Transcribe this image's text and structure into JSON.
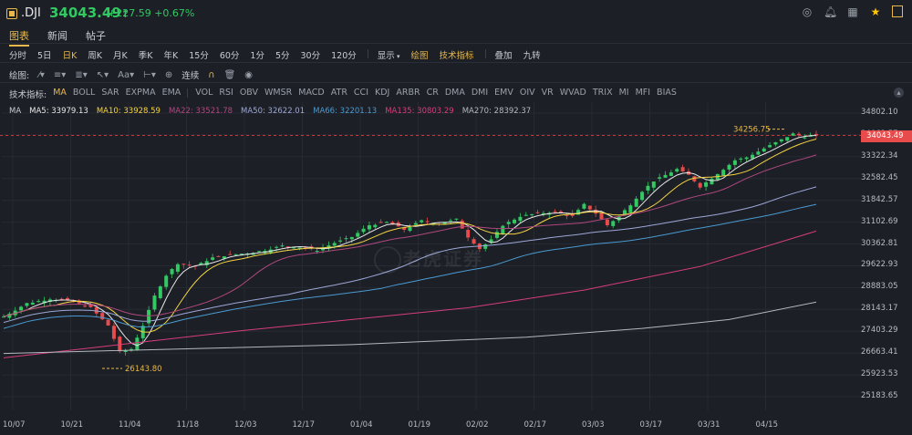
{
  "header": {
    "symbol": ".DJI",
    "price": "34043.49",
    "price_arrow": "↑",
    "change": "+227.59",
    "change_pct": "+0.67%",
    "up_color": "#32c862",
    "down_color": "#e84b4b",
    "accent": "#e8b94a"
  },
  "tabs": [
    "图表",
    "新闻",
    "帖子"
  ],
  "periods": [
    "分时",
    "5日",
    "日K",
    "周K",
    "月K",
    "季K",
    "年K",
    "15分",
    "60分",
    "1分",
    "5分",
    "30分",
    "120分"
  ],
  "period_tools": {
    "display": "显示",
    "draw": "绘图",
    "indicators": "技术指标",
    "overlay": "叠加",
    "nine": "九转"
  },
  "draw_toolbar": {
    "label": "绘图:",
    "continuous": "连续"
  },
  "indicator_bar": {
    "label": "技术指标:",
    "main": [
      "MA",
      "BOLL",
      "SAR",
      "EXPMA",
      "EMA"
    ],
    "sub": [
      "VOL",
      "RSI",
      "OBV",
      "WMSR",
      "MACD",
      "ATR",
      "CCI",
      "KDJ",
      "ARBR",
      "CR",
      "DMA",
      "DMI",
      "EMV",
      "OIV",
      "VR",
      "WVAD",
      "TRIX",
      "MI",
      "MFI",
      "BIAS"
    ]
  },
  "ma_legend": [
    {
      "text": "MA",
      "color": "#c9ccd3"
    },
    {
      "text": "MA5: 33979.13",
      "color": "#e8e8e8"
    },
    {
      "text": "MA10: 33928.59",
      "color": "#f5d442"
    },
    {
      "text": "MA22: 33521.78",
      "color": "#b0487e"
    },
    {
      "text": "MA50: 32622.01",
      "color": "#9da7d6"
    },
    {
      "text": "MA66: 32201.13",
      "color": "#4a9ad1"
    },
    {
      "text": "MA135: 30803.29",
      "color": "#d63d7e"
    },
    {
      "text": "MA270: 28392.37",
      "color": "#b5b8bf"
    }
  ],
  "watermark": "老虎证券",
  "chart_data": {
    "type": "candlestick",
    "y_ticks": [
      "34802.10",
      "34062.57",
      "33322.34",
      "32582.45",
      "31842.57",
      "31102.69",
      "30362.81",
      "29622.93",
      "28883.05",
      "28143.17",
      "27403.29",
      "26663.41",
      "25923.53",
      "25183.65"
    ],
    "y_range": [
      25183.65,
      34802.1
    ],
    "current_price_label": "34043.49",
    "x_labels": [
      "10/07",
      "10/21",
      "11/04",
      "11/18",
      "12/03",
      "12/17",
      "01/04",
      "01/19",
      "02/02",
      "02/17",
      "03/03",
      "03/17",
      "03/31",
      "04/15"
    ],
    "annotations": {
      "high": "34256.75",
      "low": "26143.80"
    },
    "close_path": [
      [
        0,
        27900
      ],
      [
        4,
        28350
      ],
      [
        8,
        28500
      ],
      [
        12,
        28400
      ],
      [
        15,
        28200
      ],
      [
        18,
        27600
      ],
      [
        20,
        26700
      ],
      [
        22,
        26800
      ],
      [
        24,
        27600
      ],
      [
        26,
        28600
      ],
      [
        28,
        29300
      ],
      [
        30,
        29700
      ],
      [
        33,
        29600
      ],
      [
        36,
        29900
      ],
      [
        39,
        30000
      ],
      [
        42,
        30050
      ],
      [
        45,
        30150
      ],
      [
        48,
        30300
      ],
      [
        51,
        30250
      ],
      [
        54,
        30150
      ],
      [
        57,
        30400
      ],
      [
        60,
        30600
      ],
      [
        63,
        31000
      ],
      [
        66,
        31100
      ],
      [
        69,
        30850
      ],
      [
        72,
        31150
      ],
      [
        75,
        31050
      ],
      [
        78,
        31200
      ],
      [
        80,
        30600
      ],
      [
        82,
        30200
      ],
      [
        84,
        30500
      ],
      [
        86,
        31000
      ],
      [
        89,
        31300
      ],
      [
        92,
        31400
      ],
      [
        95,
        31450
      ],
      [
        98,
        31300
      ],
      [
        100,
        31700
      ],
      [
        102,
        31400
      ],
      [
        104,
        31000
      ],
      [
        106,
        31300
      ],
      [
        108,
        31700
      ],
      [
        110,
        32150
      ],
      [
        112,
        32500
      ],
      [
        114,
        32700
      ],
      [
        116,
        32900
      ],
      [
        118,
        32700
      ],
      [
        120,
        32300
      ],
      [
        122,
        32600
      ],
      [
        124,
        32900
      ],
      [
        126,
        33200
      ],
      [
        128,
        33300
      ],
      [
        130,
        33500
      ],
      [
        132,
        33700
      ],
      [
        134,
        33900
      ],
      [
        136,
        34100
      ],
      [
        138,
        34000
      ],
      [
        140,
        34043
      ]
    ]
  }
}
